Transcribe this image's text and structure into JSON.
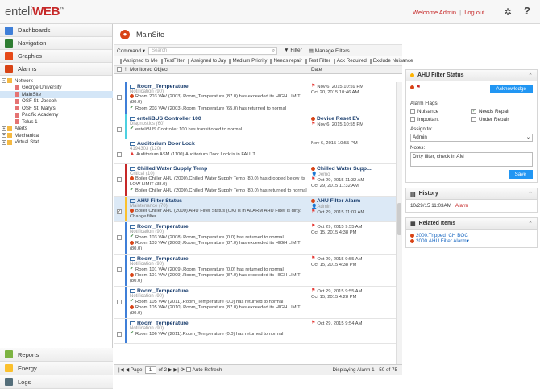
{
  "header": {
    "logo_prefix": "enteli",
    "logo_accent": "WEB",
    "logo_tm": "™",
    "welcome": "Welcome",
    "user": "Admin",
    "sep": "|",
    "logout": "Log out",
    "help": "?"
  },
  "sidebar": {
    "top": [
      {
        "label": "Dashboards",
        "icon": "dashboard-icon"
      },
      {
        "label": "Navigation",
        "icon": "navigation-icon"
      },
      {
        "label": "Graphics",
        "icon": "graphics-icon"
      },
      {
        "label": "Alarms",
        "icon": "alarm-icon"
      }
    ],
    "tree": [
      {
        "label": "Network",
        "depth": 0,
        "pm": "−"
      },
      {
        "label": "George University",
        "depth": 2
      },
      {
        "label": "MainSite",
        "depth": 2,
        "selected": true
      },
      {
        "label": "OSF St. Joseph",
        "depth": 2
      },
      {
        "label": "OSF St. Mary's",
        "depth": 2
      },
      {
        "label": "Pacific Academy",
        "depth": 2
      },
      {
        "label": "Telus 1",
        "depth": 2
      },
      {
        "label": "Alerts",
        "depth": 0,
        "pm": "+"
      },
      {
        "label": "Mechanical",
        "depth": 0,
        "pm": "+"
      },
      {
        "label": "Virtual Stat",
        "depth": 0,
        "pm": "+"
      }
    ],
    "bottom": [
      {
        "label": "Reports",
        "icon": "reports-icon"
      },
      {
        "label": "Energy",
        "icon": "energy-icon"
      },
      {
        "label": "Logs",
        "icon": "logs-icon"
      }
    ]
  },
  "main": {
    "title": "MainSite",
    "command": "Command ▾",
    "search_placeholder": "Search",
    "filter": "Filter",
    "manage_filters": "Manage Filters",
    "filter_chips": [
      "Assigned to Me",
      "TestFilter",
      "Assigned to Jay",
      "Medium Priority",
      "Needs repair",
      "Test Filter",
      "Ack Required",
      "Exclude Nuisance"
    ],
    "col_object": "Monitored Object",
    "col_date": "Date",
    "rows": [
      {
        "title": "Room_Temperature",
        "sub": "Notification (90)",
        "bar": "#3f7fd8",
        "lines": [
          {
            "mk": "red",
            "t": "Room 203 VAV (2003).Room_Temperature (87.0) has exceeded its HIGH LIMIT (80.0)"
          },
          {
            "mk": "check",
            "t": "Room 203 VAV (2003).Room_Temperature (65.0) has returned to normal"
          }
        ],
        "dtitle": "",
        "dsub": "",
        "dates": [
          "Nov 6, 2015 10:59 PM",
          "Oct 20, 2015 10:46 AM"
        ],
        "dmk": "tri"
      },
      {
        "title": "enteliBUS Controller 100",
        "sub": "Diagnostics (60)",
        "bar": "#4dd0e1",
        "lines": [
          {
            "mk": "check",
            "t": "enteliBUS Controller 100 has transitioned to normal"
          }
        ],
        "dtitle": "Device Reset EV",
        "dsub": "",
        "dates": [
          "Nov 6, 2015 10:55 PM"
        ],
        "dmk": "tri"
      },
      {
        "title": "Auditorium Door Lock",
        "sub": "4194303 (120)",
        "bar": "#ffffff",
        "lines": [
          {
            "mk": "tri",
            "t": "Auditorium ASM (1100).Auditorium Door Lock is in FAULT"
          }
        ],
        "dtitle": "",
        "dsub": "",
        "dates": [
          "Nov 6, 2015 10:55 PM"
        ],
        "dmk": ""
      },
      {
        "title": "Chilled Water Supply Temp",
        "sub": "Critical (10)",
        "bar": "#c62828",
        "lines": [
          {
            "mk": "red",
            "t": "Boiler Chiller AHU (2000).Chilled Water Supply Temp (80.0) has dropped below its LOW LIMIT (38.0)"
          },
          {
            "mk": "check",
            "t": "Boiler Chiller AHU (2000).Chilled Water Supply Temp (80.0) has returned to normal"
          }
        ],
        "dtitle": "Chilled Water Supp...",
        "dsub": "Demo",
        "dates": [
          "Oct 29, 2015 11:32 AM",
          "Oct 29, 2015 11:32 AM"
        ],
        "dmk": "tri"
      },
      {
        "title": "AHU Filter Status",
        "sub": "Maintenance (70)",
        "bar": "#fbc02d",
        "selected": true,
        "lines": [
          {
            "mk": "red",
            "t": "Boiler Chiller AHU (2000).AHU Filter Status (OK) is in ALARM AHU Filter is dirty. Change filter."
          }
        ],
        "dtitle": "AHU Filter Alarm",
        "dsub": "Admin",
        "dates": [
          "Oct 29, 2015 11:03 AM"
        ],
        "dmk": "tri"
      },
      {
        "title": "Room_Temperature",
        "sub": "Notification (90)",
        "bar": "#3f7fd8",
        "lines": [
          {
            "mk": "check",
            "t": "Room 103 VAV (2008).Room_Temperature (0.0) has returned to normal"
          },
          {
            "mk": "red",
            "t": "Room 103 VAV (2008).Room_Temperature (87.0) has exceeded its HIGH LIMIT (80.0)"
          }
        ],
        "dtitle": "",
        "dsub": "",
        "dates": [
          "Oct 29, 2015 9:55 AM",
          "Oct 15, 2015 4:38 PM"
        ],
        "dmk": "tri"
      },
      {
        "title": "Room_Temperature",
        "sub": "Notification (90)",
        "bar": "#3f7fd8",
        "lines": [
          {
            "mk": "check",
            "t": "Room 101 VAV (2009).Room_Temperature (0.0) has returned to normal"
          },
          {
            "mk": "red",
            "t": "Room 101 VAV (2009).Room_Temperature (87.0) has exceeded its HIGH LIMIT (80.0)"
          }
        ],
        "dtitle": "",
        "dsub": "",
        "dates": [
          "Oct 29, 2015 9:55 AM",
          "Oct 15, 2015 4:38 PM"
        ],
        "dmk": "tri"
      },
      {
        "title": "Room_Temperature",
        "sub": "Notification (90)",
        "bar": "#3f7fd8",
        "lines": [
          {
            "mk": "check",
            "t": "Room 105 VAV (2011).Room_Temperature (0.0) has returned to normal"
          },
          {
            "mk": "red",
            "t": "Room 105 VAV (2010).Room_Temperature (87.0) has exceeded its HIGH LIMIT (80.0)"
          }
        ],
        "dtitle": "",
        "dsub": "",
        "dates": [
          "Oct 29, 2015 9:55 AM",
          "Oct 15, 2015 4:28 PM"
        ],
        "dmk": "tri"
      },
      {
        "title": "Room_Temperature",
        "sub": "Notification (90)",
        "bar": "#3f7fd8",
        "lines": [
          {
            "mk": "check",
            "t": "Room 106 VAV (2011).Room_Temperature (0.0) has returned to normal"
          }
        ],
        "dtitle": "",
        "dsub": "",
        "dates": [
          "Oct 29, 2015 9:54 AM"
        ],
        "dmk": "tri"
      }
    ],
    "pager": {
      "page_label": "Page",
      "page": "1",
      "of": "of 2",
      "auto_refresh": "Auto Refresh",
      "displaying": "Displaying Alarm 1 - 50 of 75"
    }
  },
  "detail": {
    "title": "AHU Filter Status",
    "acknowledge": "Acknowledge",
    "flags_label": "Alarm Flags:",
    "flags": [
      {
        "label": "Nuisance",
        "checked": false
      },
      {
        "label": "Needs Repair",
        "checked": true
      },
      {
        "label": "Important",
        "checked": false
      },
      {
        "label": "Under Repair",
        "checked": false
      }
    ],
    "assign_label": "Assign to:",
    "assign_value": "Admin",
    "notes_label": "Notes:",
    "notes_value": "Dirty filter, check in AM",
    "save": "Save"
  },
  "history": {
    "title": "History",
    "time": "10/29/15 11:03AM",
    "state": "Alarm"
  },
  "related": {
    "title": "Related Items",
    "items": [
      "2000.Tripped_CH BOC",
      "2000.AHU Filter Alarm▾"
    ]
  }
}
